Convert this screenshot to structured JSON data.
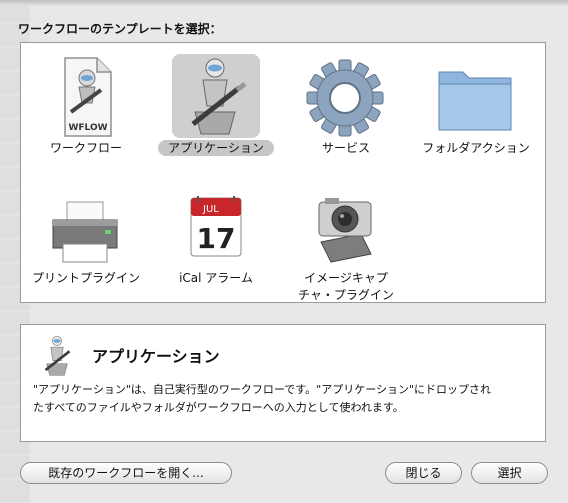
{
  "dialog": {
    "title": "ワークフローのテンプレートを選択："
  },
  "templates": [
    {
      "label": "ワークフロー",
      "icon": "workflow-file-icon",
      "badge": "WFLOW"
    },
    {
      "label": "アプリケーション",
      "icon": "automator-robot-icon"
    },
    {
      "label": "サービス",
      "icon": "gear-icon"
    },
    {
      "label": "フォルダアクション",
      "icon": "folder-icon"
    },
    {
      "label": "プリントプラグイン",
      "icon": "printer-icon"
    },
    {
      "label": "iCal アラーム",
      "icon": "calendar-icon",
      "cal_month": "JUL",
      "cal_day": "17"
    },
    {
      "label": "イメージキャプチャ・プラグイン",
      "line1": "イメージキャプ",
      "line2": "チャ・プラグイン",
      "icon": "camera-icon"
    }
  ],
  "selected_index": 1,
  "description": {
    "title": "アプリケーション",
    "text_line1": "\"アプリケーション\"は、自己実行型のワークフローです。\"アプリケーション\"にドロップされ",
    "text_line2": "たすべてのファイルやフォルダがワークフローへの入力として使われます。"
  },
  "buttons": {
    "open_existing": "既存のワークフローを開く...",
    "close": "閉じる",
    "choose": "選択"
  },
  "colors": {
    "accent_blue": "#6fa6d6",
    "selection_gray": "#cfcfcf",
    "calendar_red": "#c8262a"
  }
}
